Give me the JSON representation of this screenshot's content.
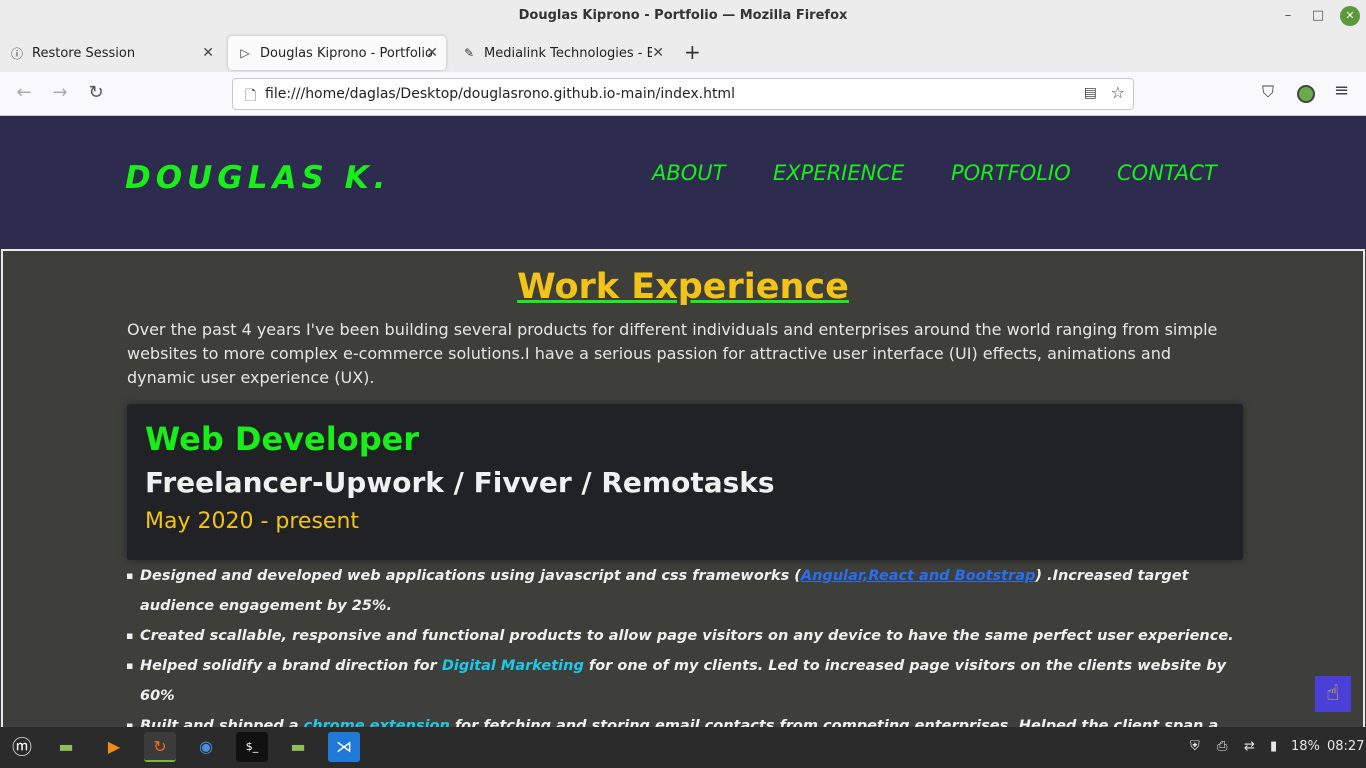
{
  "window": {
    "title": "Douglas Kiprono - Portfolio — Mozilla Firefox",
    "minimize": "–",
    "maximize": "□",
    "close": "✕"
  },
  "tabs": [
    {
      "label": "Restore Session",
      "icon": "info-icon",
      "glyph": "ⓘ",
      "close": "✕"
    },
    {
      "label": "Douglas Kiprono - Portfolio",
      "icon": "play-icon",
      "glyph": "▷",
      "close": "✕"
    },
    {
      "label": "Medialink Technologies - Be",
      "icon": "medialink-icon",
      "glyph": "✎",
      "close": "✕"
    }
  ],
  "new_tab": "+",
  "nav": {
    "back": "←",
    "forward": "→",
    "reload": "↻",
    "url": "file:///home/daglas/Desktop/douglasrono.github.io-main/index.html",
    "page_glyph": "🗋",
    "reader_glyph": "▤",
    "bookmark_glyph": "☆",
    "pocket_glyph": "⛉",
    "menu_glyph": "≡"
  },
  "site": {
    "logo": "DOUGLAS K.",
    "menu": [
      "ABOUT",
      "EXPERIENCE",
      "PORTFOLIO",
      "CONTACT"
    ],
    "section_title": "Work Experience",
    "intro": "Over the past 4 years I've been building several products for different individuals and enterprises around the world ranging from simple websites to more complex e-commerce solutions.I have a serious passion for attractive user interface (UI) effects, animations and dynamic user experience (UX).",
    "card": {
      "role": "Web Developer",
      "company": "Freelancer-Upwork / Fivver / Remotasks",
      "period": "May 2020 - present"
    },
    "bullets": {
      "b1_pre": "Designed and developed web applications using javascript and css frameworks (",
      "b1_link": "Angular,React and Bootstrap",
      "b1_post": ") .Increased target audience engagement by 25%.",
      "b2": "Created scallable, responsive and functional products to allow page visitors on any device to have the same perfect user experience.",
      "b3_pre": "Helped solidify a brand direction for ",
      "b3_link": "Digital Marketing",
      "b3_post": " for one of my clients. Led to increased page visitors on the clients website by 60%",
      "b4_pre": "Built and shipped a ",
      "b4_link": "chrome extension",
      "b4_post": " for fetching and storing email contacts from competing enterprises. Helped the client span a"
    },
    "fab_glyph": "☝"
  },
  "taskbar": {
    "apps": [
      {
        "name": "mint-menu-icon",
        "glyph": "ⓜ"
      },
      {
        "name": "files-icon",
        "glyph": "▬"
      },
      {
        "name": "media-player-icon",
        "glyph": "▶"
      },
      {
        "name": "firefox-icon",
        "glyph": "↻"
      },
      {
        "name": "chrome-icon",
        "glyph": "◉"
      },
      {
        "name": "terminal-icon",
        "glyph": "$_"
      },
      {
        "name": "folder-icon",
        "glyph": "▬"
      },
      {
        "name": "vscode-icon",
        "glyph": "⋊"
      }
    ],
    "battery": "18%",
    "time": "08:27"
  },
  "colors": {
    "accent_green": "#1aee1a",
    "accent_yellow": "#f2c41a",
    "header_bg": "#2d2c4e",
    "page_bg": "#3e3f3b"
  }
}
